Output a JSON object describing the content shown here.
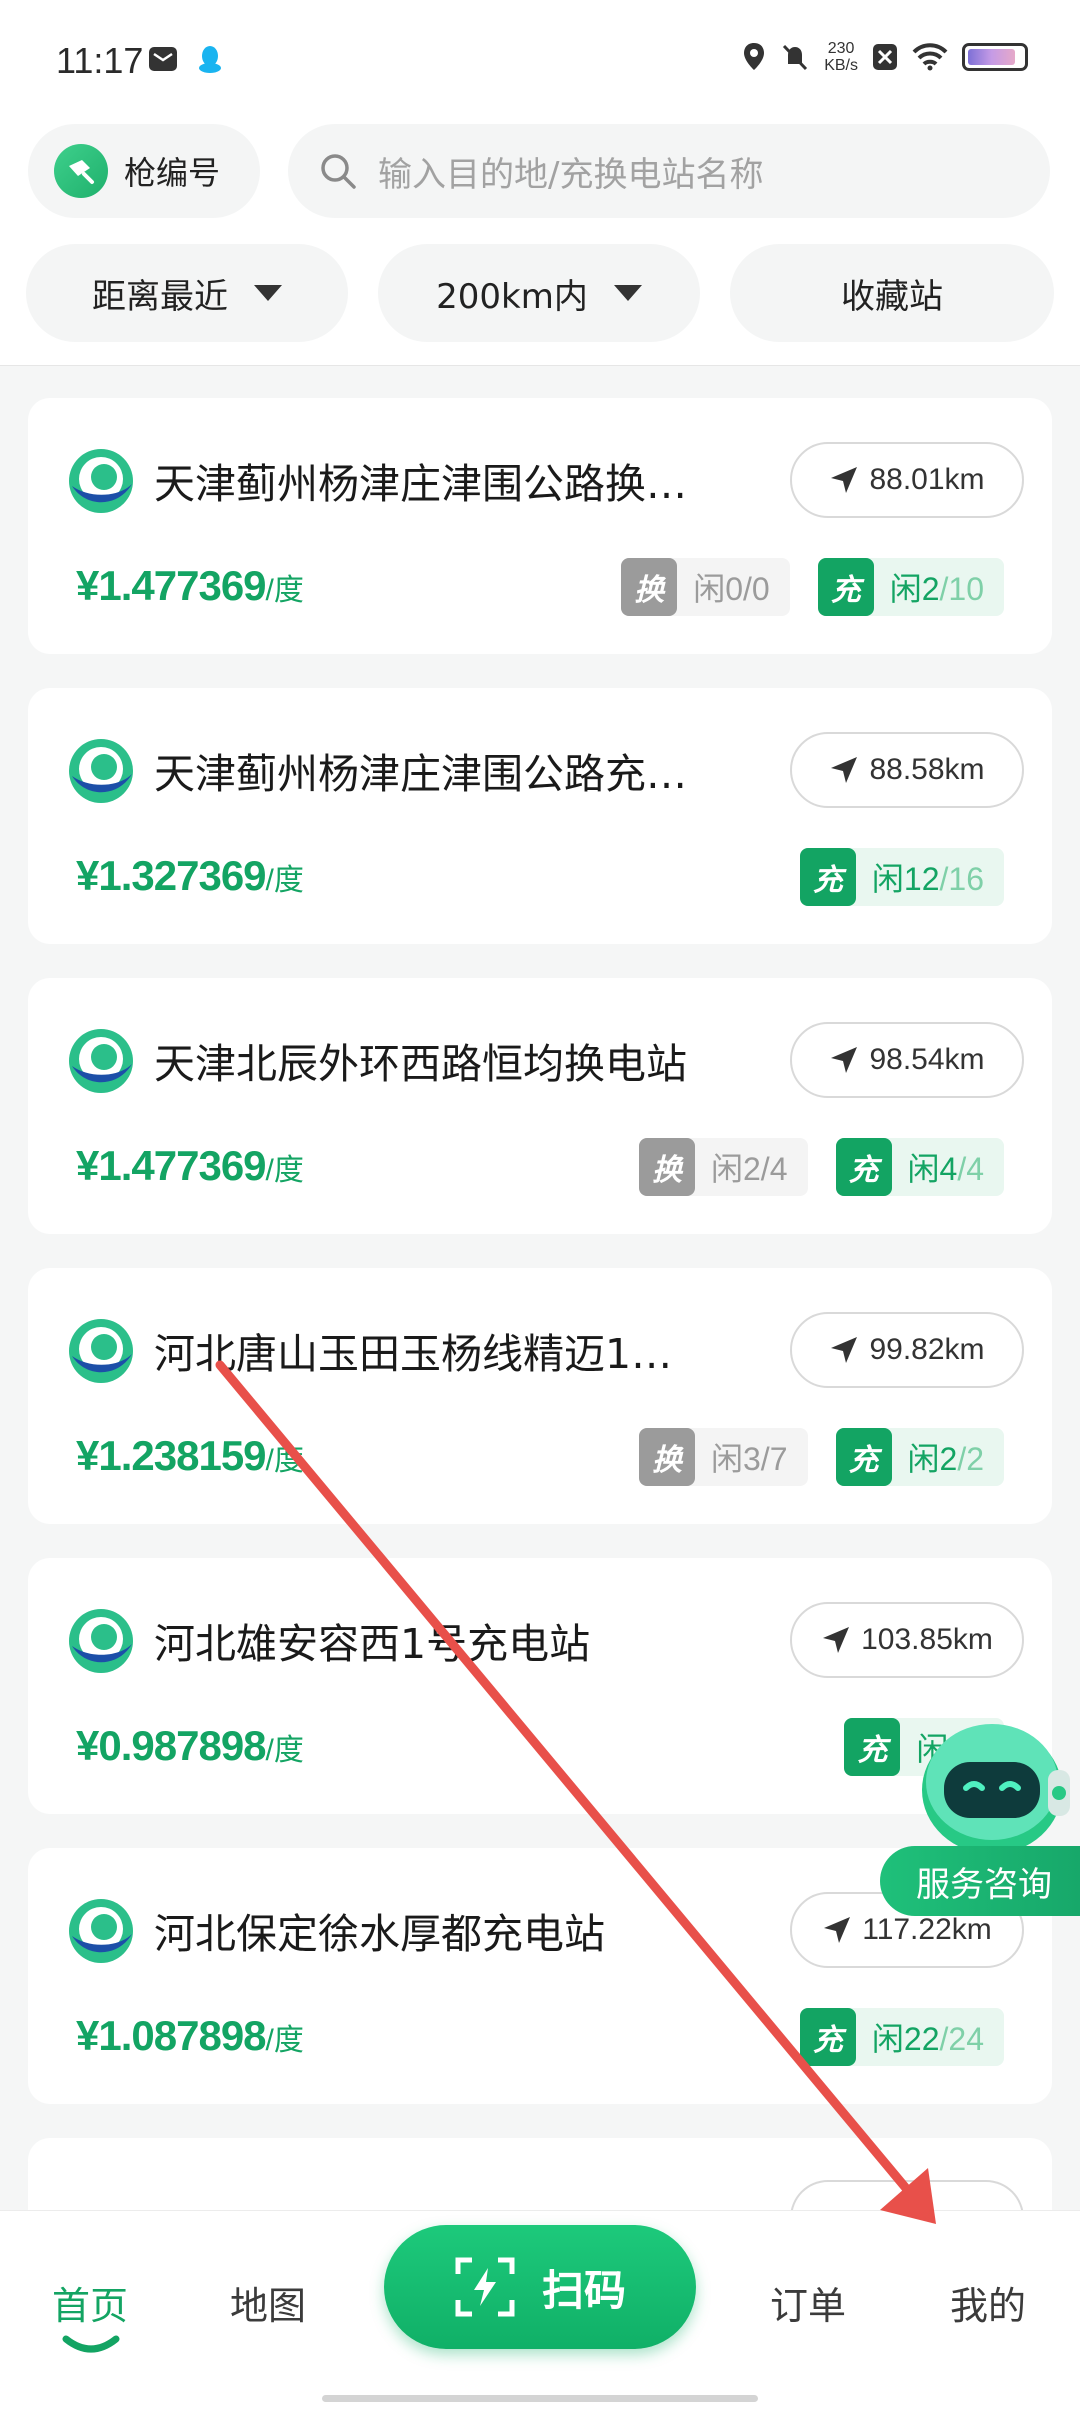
{
  "status_bar": {
    "time": "11:17",
    "net_speed_value": "230",
    "net_speed_unit": "KB/s"
  },
  "header": {
    "gun_button_label": "枪编号",
    "search_placeholder": "输入目的地/充换电站名称",
    "filters": [
      {
        "label": "距离最近",
        "has_dropdown": true
      },
      {
        "label": "200km内",
        "has_dropdown": true
      },
      {
        "label": "收藏站",
        "has_dropdown": false
      }
    ]
  },
  "stations": [
    {
      "name": "天津蓟州杨津庄津围公路换…",
      "distance": "88.01km",
      "price": "¥1.477369",
      "unit": "/度",
      "swap": {
        "tag": "换",
        "free_text": "闲0/0"
      },
      "charge": {
        "tag": "充",
        "free": "闲2",
        "total": "/10"
      }
    },
    {
      "name": "天津蓟州杨津庄津围公路充…",
      "distance": "88.58km",
      "price": "¥1.327369",
      "unit": "/度",
      "charge": {
        "tag": "充",
        "free": "闲12",
        "total": "/16"
      }
    },
    {
      "name": "天津北辰外环西路恒均换电站",
      "distance": "98.54km",
      "price": "¥1.477369",
      "unit": "/度",
      "swap": {
        "tag": "换",
        "free_text": "闲2/4"
      },
      "charge": {
        "tag": "充",
        "free": "闲4",
        "total": "/4"
      }
    },
    {
      "name": "河北唐山玉田玉杨线精迈1…",
      "distance": "99.82km",
      "price": "¥1.238159",
      "unit": "/度",
      "swap": {
        "tag": "换",
        "free_text": "闲3/7"
      },
      "charge": {
        "tag": "充",
        "free": "闲2",
        "total": "/2"
      }
    },
    {
      "name": "河北雄安容西1号充电站",
      "distance": "103.85km",
      "price": "¥0.987898",
      "unit": "/度",
      "charge": {
        "tag": "充",
        "free": "闲12",
        "total": ""
      }
    },
    {
      "name": "河北保定徐水厚都充电站",
      "distance": "117.22km",
      "price": "¥1.087898",
      "unit": "/度",
      "charge": {
        "tag": "充",
        "free": "闲22",
        "total": "/24"
      }
    }
  ],
  "service_float": {
    "label": "服务咨询"
  },
  "bottom_nav": {
    "home": "首页",
    "map": "地图",
    "scan": "扫码",
    "orders": "订单",
    "mine": "我的"
  },
  "colors": {
    "accent": "#13a463",
    "annotation_arrow": "#e8504a"
  }
}
